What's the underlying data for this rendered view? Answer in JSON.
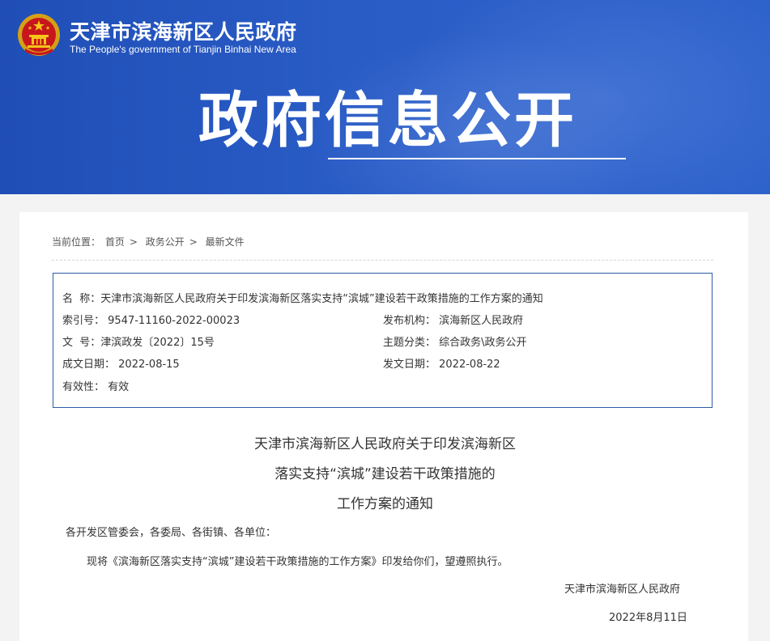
{
  "header": {
    "site_name_cn": "天津市滨海新区人民政府",
    "site_name_en": "The People's government of Tianjin Binhai New Area",
    "section_title": "政府信息公开",
    "colors": {
      "banner": "#2a5cc6",
      "box_border": "#2e5ba8"
    }
  },
  "breadcrumb": {
    "prefix": "当前位置：",
    "items": [
      "首页",
      "政务公开",
      "最新文件"
    ],
    "separator": ">"
  },
  "meta": {
    "name_label": "名  称：",
    "name_value": "天津市滨海新区人民政府关于印发滨海新区落实支持“滨城”建设若干政策措施的工作方案的通知",
    "index_label": "索引号：",
    "index_value": "9547-11160-2022-00023",
    "publisher_label": "发布机构：",
    "publisher_value": "滨海新区人民政府",
    "docno_label": "文  号：",
    "docno_value": "津滨政发〔2022〕15号",
    "topic_label": "主题分类：",
    "topic_value": "综合政务\\政务公开",
    "created_label": "成文日期：",
    "created_value": "2022-08-15",
    "issued_label": "发文日期：",
    "issued_value": "2022-08-22",
    "valid_label": "有效性：",
    "valid_value": "有效"
  },
  "document": {
    "title_lines": [
      "天津市滨海新区人民政府关于印发滨海新区",
      "落实支持“滨城”建设若干政策措施的",
      "工作方案的通知"
    ],
    "salutation": "各开发区管委会，各委局、各街镇、各单位：",
    "paragraph": "现将《滨海新区落实支持“滨城”建设若干政策措施的工作方案》印发给你们，望遵照执行。",
    "signer": "天津市滨海新区人民政府",
    "date": "2022年8月11日"
  }
}
